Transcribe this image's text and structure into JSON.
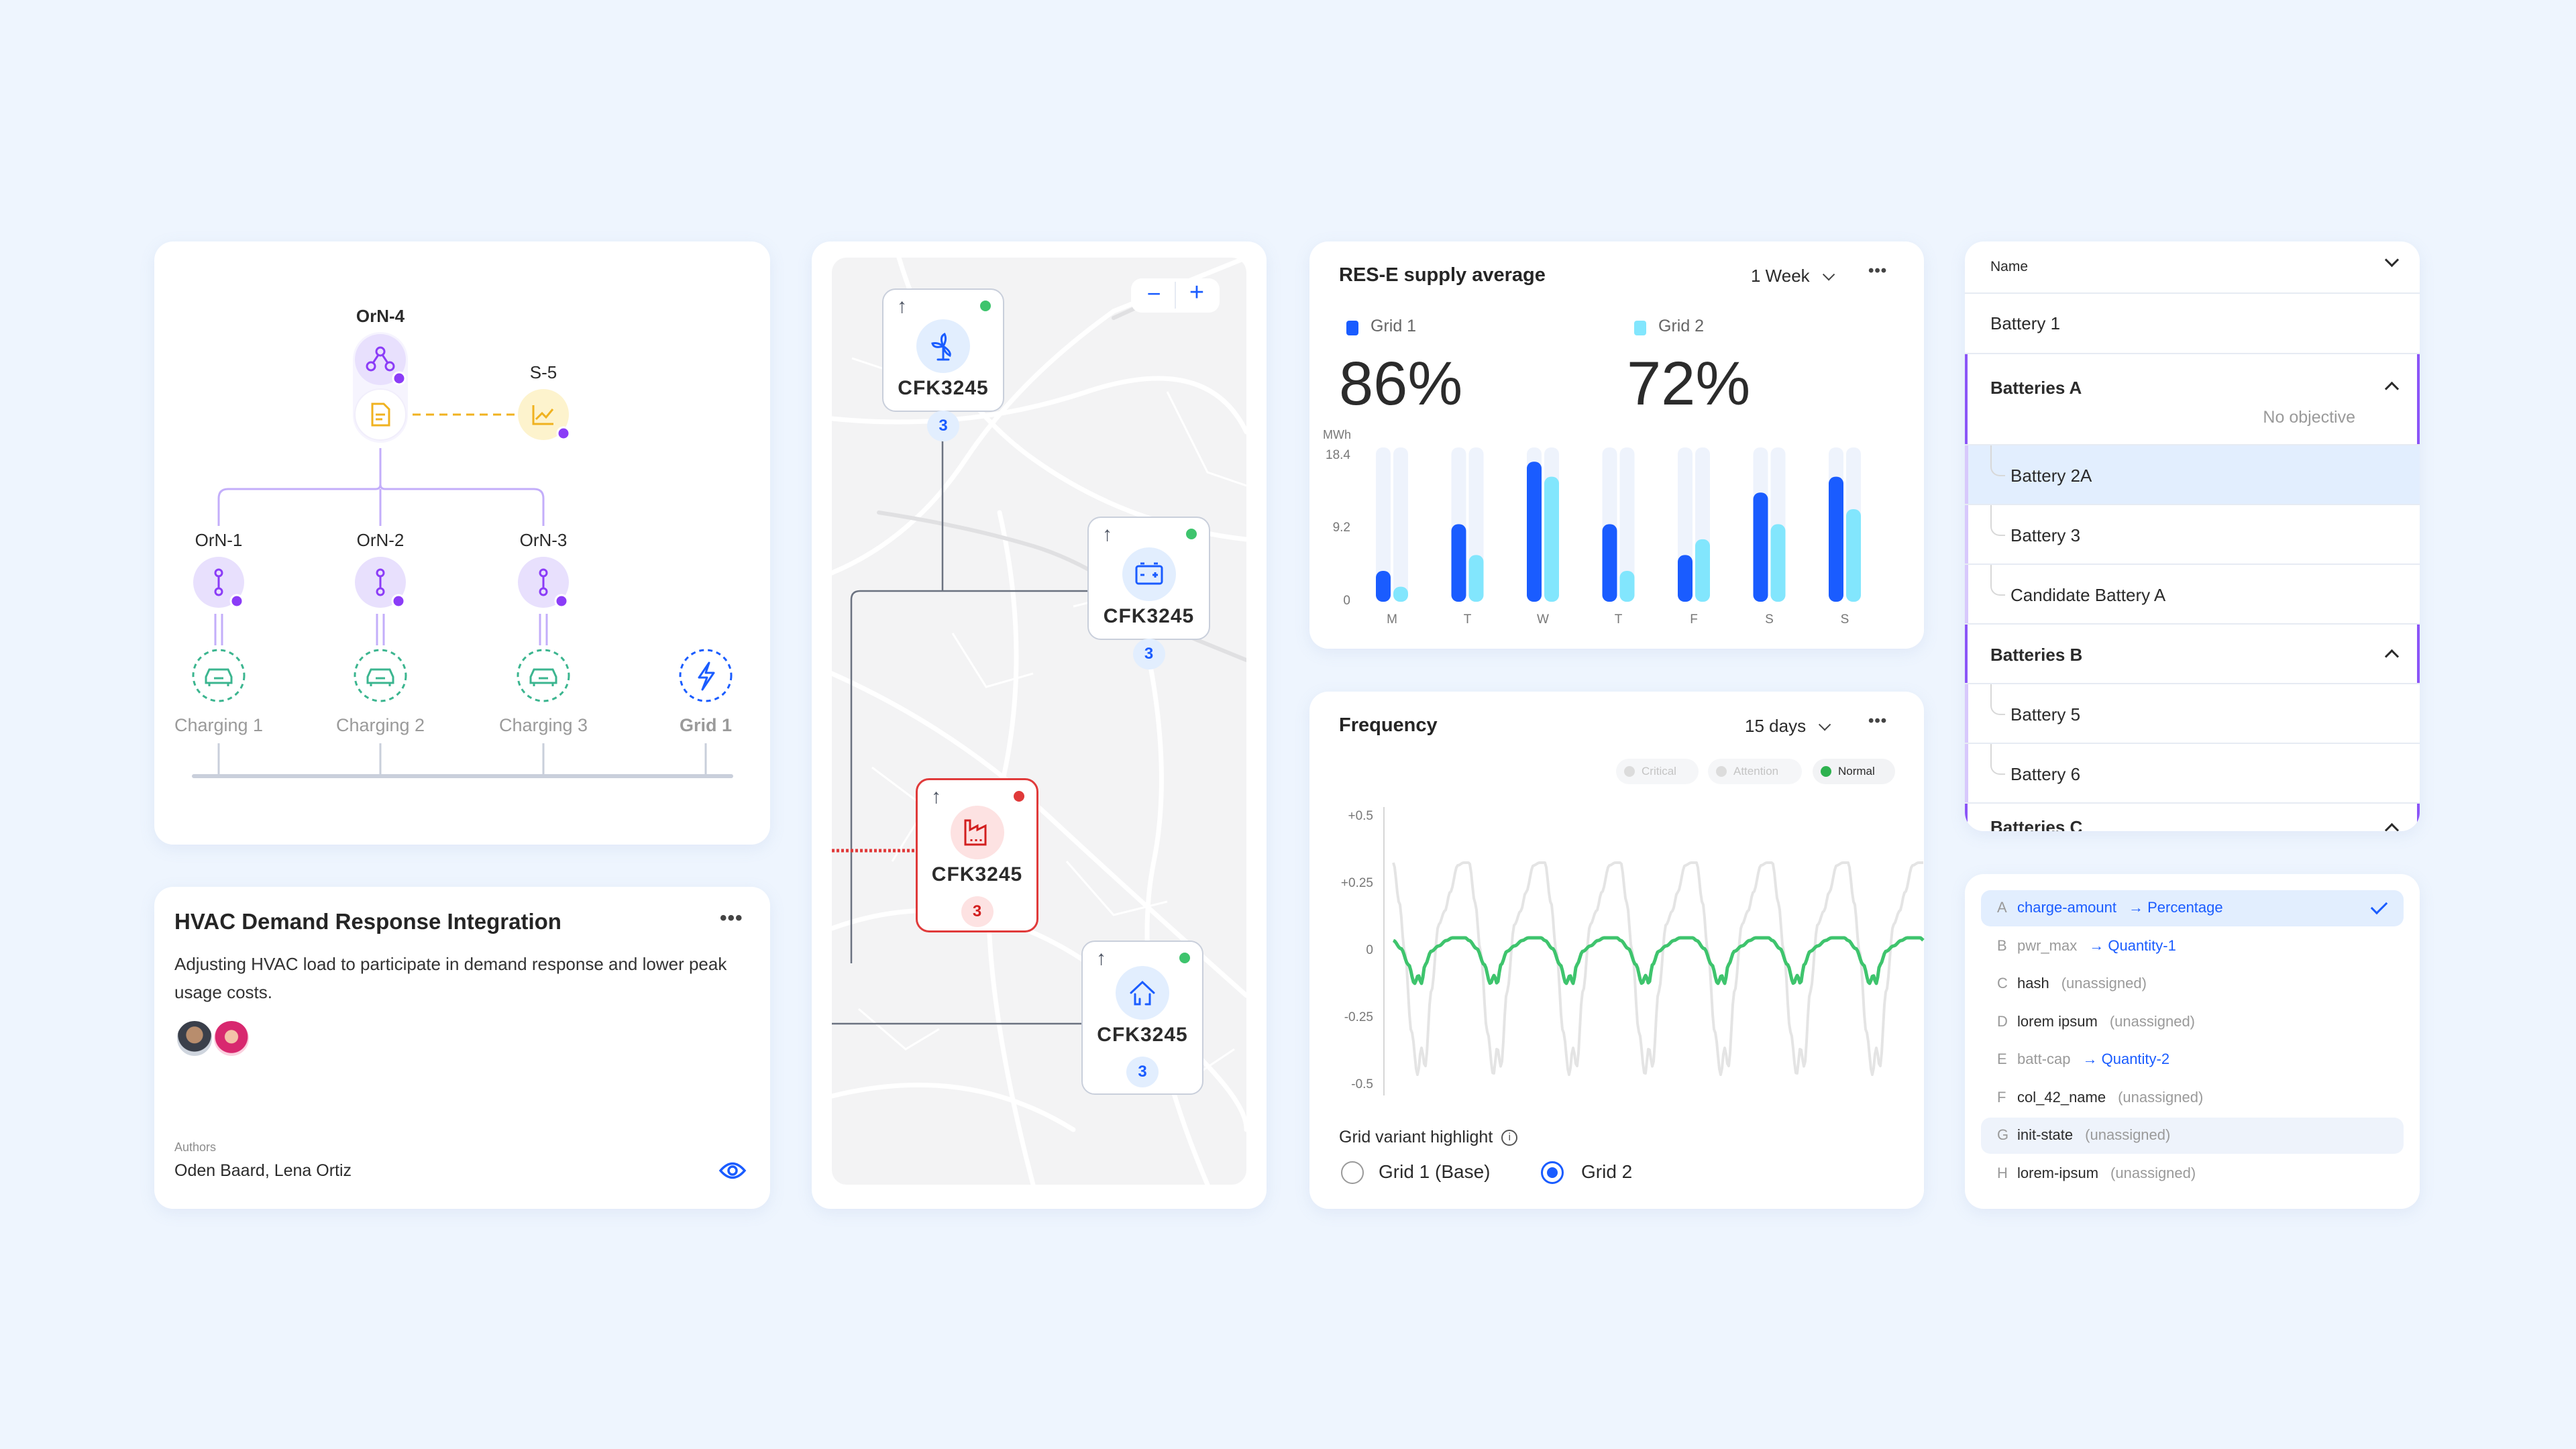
{
  "colors": {
    "background": "#eef5fe",
    "accent_blue": "#1a5cff",
    "accent_cyan": "#82e6fd",
    "purple": "#8b55f7",
    "orange": "#f0b21f",
    "teal": "#3bb58f",
    "red": "#e03a3a",
    "green": "#2eb24f"
  },
  "topology": {
    "root": {
      "label": "OrN-4",
      "icon": "hierarchy-icon",
      "sub_icon": "document-icon"
    },
    "side": {
      "label": "S-5",
      "icon": "line-chart-icon"
    },
    "children": [
      {
        "label": "OrN-1",
        "icon": "path-icon",
        "endpoint": {
          "label": "Charging 1",
          "icon": "car-icon"
        }
      },
      {
        "label": "OrN-2",
        "icon": "path-icon",
        "endpoint": {
          "label": "Charging 2",
          "icon": "car-icon"
        }
      },
      {
        "label": "OrN-3",
        "icon": "path-icon",
        "endpoint": {
          "label": "Charging 3",
          "icon": "car-icon"
        }
      }
    ],
    "grid": {
      "label": "Grid 1",
      "icon": "lightning-icon"
    }
  },
  "hvac_card": {
    "title": "HVAC Demand Response Integration",
    "more_label": "•••",
    "description": "Adjusting HVAC load to participate in demand response and lower peak usage costs.",
    "authors_label": "Authors",
    "authors": "Oden Baard, Lena Ortiz",
    "avatars": [
      {
        "name": "Oden Baard"
      },
      {
        "name": "Lena Ortiz"
      }
    ],
    "view_icon": "eye-icon"
  },
  "map": {
    "zoom_out_label": "−",
    "zoom_in_label": "+",
    "nodes": [
      {
        "id": "CFK3245",
        "icon": "wind-turbine-icon",
        "count": "3",
        "status": "normal",
        "arrow": "↑"
      },
      {
        "id": "CFK3245",
        "icon": "battery-icon",
        "count": "3",
        "status": "normal",
        "arrow": "↑"
      },
      {
        "id": "CFK3245",
        "icon": "factory-icon",
        "count": "3",
        "status": "critical",
        "arrow": "↑"
      },
      {
        "id": "CFK3245",
        "icon": "home-icon",
        "count": "3",
        "status": "normal",
        "arrow": "↑"
      }
    ]
  },
  "res_card": {
    "title": "RES-E supply average",
    "range_label": "1 Week",
    "more_label": "•••",
    "kpis": [
      {
        "label": "Grid 1",
        "value": "86%",
        "color": "#1a5cff"
      },
      {
        "label": "Grid 2",
        "value": "72%",
        "color": "#82e6fd"
      }
    ]
  },
  "freq_card": {
    "title": "Frequency",
    "range_label": "15 days",
    "more_label": "•••",
    "status_filters": [
      {
        "label": "Critical",
        "active": false
      },
      {
        "label": "Attention",
        "active": false
      },
      {
        "label": "Normal",
        "active": true
      }
    ],
    "variant_label": "Grid variant highlight",
    "variant_options": [
      {
        "label": "Grid 1 (Base)",
        "selected": false
      },
      {
        "label": "Grid 2",
        "selected": true
      }
    ]
  },
  "chart_data": [
    {
      "type": "bar",
      "title": "RES-E supply average",
      "ylabel": "MWh",
      "xlabel": "",
      "categories": [
        "M",
        "T",
        "W",
        "T",
        "F",
        "S",
        "S"
      ],
      "series": [
        {
          "name": "Grid 1",
          "color": "#1a5cff",
          "values": [
            3.9,
            9.8,
            17.7,
            9.8,
            5.9,
            13.8,
            15.8
          ]
        },
        {
          "name": "Grid 2",
          "color": "#82e6fd",
          "values": [
            1.9,
            5.9,
            15.8,
            3.9,
            7.9,
            9.8,
            11.7
          ]
        }
      ],
      "yticks": [
        "0",
        "9.2",
        "18.4"
      ],
      "ylim": [
        0,
        19.5
      ],
      "grid": false,
      "legend": "top-left"
    },
    {
      "type": "line",
      "title": "Frequency",
      "ylabel": "",
      "xlabel": "",
      "yticks": [
        "+0.5",
        "+0.25",
        "0",
        "-0.25",
        "-0.5"
      ],
      "ylim": [
        -0.5,
        0.5
      ],
      "cycles": 7,
      "series": [
        {
          "name": "Grid 1 (Base)",
          "color": "#e4e4e4",
          "cycle_phase": [
            0,
            0.08,
            0.15,
            0.24,
            0.32,
            0.37,
            0.42,
            0.5,
            0.6,
            0.68,
            0.75,
            0.85,
            0.93,
            1.0
          ],
          "cycle_values": [
            0.33,
            0.18,
            0.0,
            -0.3,
            -0.46,
            -0.36,
            -0.43,
            -0.15,
            0.1,
            0.15,
            0.22,
            0.32,
            0.33,
            0.33
          ]
        },
        {
          "name": "Grid 2",
          "color": "#3ec46d",
          "cycle_phase": [
            0,
            0.1,
            0.2,
            0.28,
            0.33,
            0.37,
            0.42,
            0.5,
            0.6,
            0.7,
            0.78,
            0.88,
            0.95,
            1.0
          ],
          "cycle_values": [
            0.04,
            0.01,
            -0.05,
            -0.12,
            -0.09,
            -0.12,
            -0.05,
            0.0,
            0.02,
            0.04,
            0.05,
            0.05,
            0.05,
            0.04
          ]
        }
      ],
      "legend": "none"
    }
  ],
  "tree": {
    "header": "Name",
    "rows": [
      {
        "type": "item",
        "label": "Battery 1"
      },
      {
        "type": "group",
        "label": "Batteries A",
        "meta": "No objective",
        "expanded": true
      },
      {
        "type": "child",
        "label": "Battery 2A",
        "selected": true
      },
      {
        "type": "child",
        "label": "Battery 3"
      },
      {
        "type": "child",
        "label": "Candidate Battery A"
      },
      {
        "type": "group",
        "label": "Batteries B",
        "expanded": true
      },
      {
        "type": "child",
        "label": "Battery 5"
      },
      {
        "type": "child",
        "label": "Battery 6"
      },
      {
        "type": "group",
        "label": "Batteries C",
        "expanded": true
      }
    ]
  },
  "mapping": {
    "rows": [
      {
        "letter": "A",
        "key": "charge-amount",
        "target": "→ Percentage",
        "assigned": true,
        "selected": true
      },
      {
        "letter": "B",
        "key": "pwr_max",
        "target": "→ Quantity-1",
        "assigned": true
      },
      {
        "letter": "C",
        "key": "hash",
        "target": "(unassigned)",
        "assigned": false
      },
      {
        "letter": "D",
        "key": "lorem ipsum",
        "target": "(unassigned)",
        "assigned": false
      },
      {
        "letter": "E",
        "key": "batt-cap",
        "target": "→ Quantity-2",
        "assigned": true
      },
      {
        "letter": "F",
        "key": "col_42_name",
        "target": "(unassigned)",
        "assigned": false
      },
      {
        "letter": "G",
        "key": "init-state",
        "target": "(unassigned)",
        "assigned": false,
        "hovered": true
      },
      {
        "letter": "H",
        "key": "lorem-ipsum",
        "target": "(unassigned)",
        "assigned": false
      }
    ]
  }
}
